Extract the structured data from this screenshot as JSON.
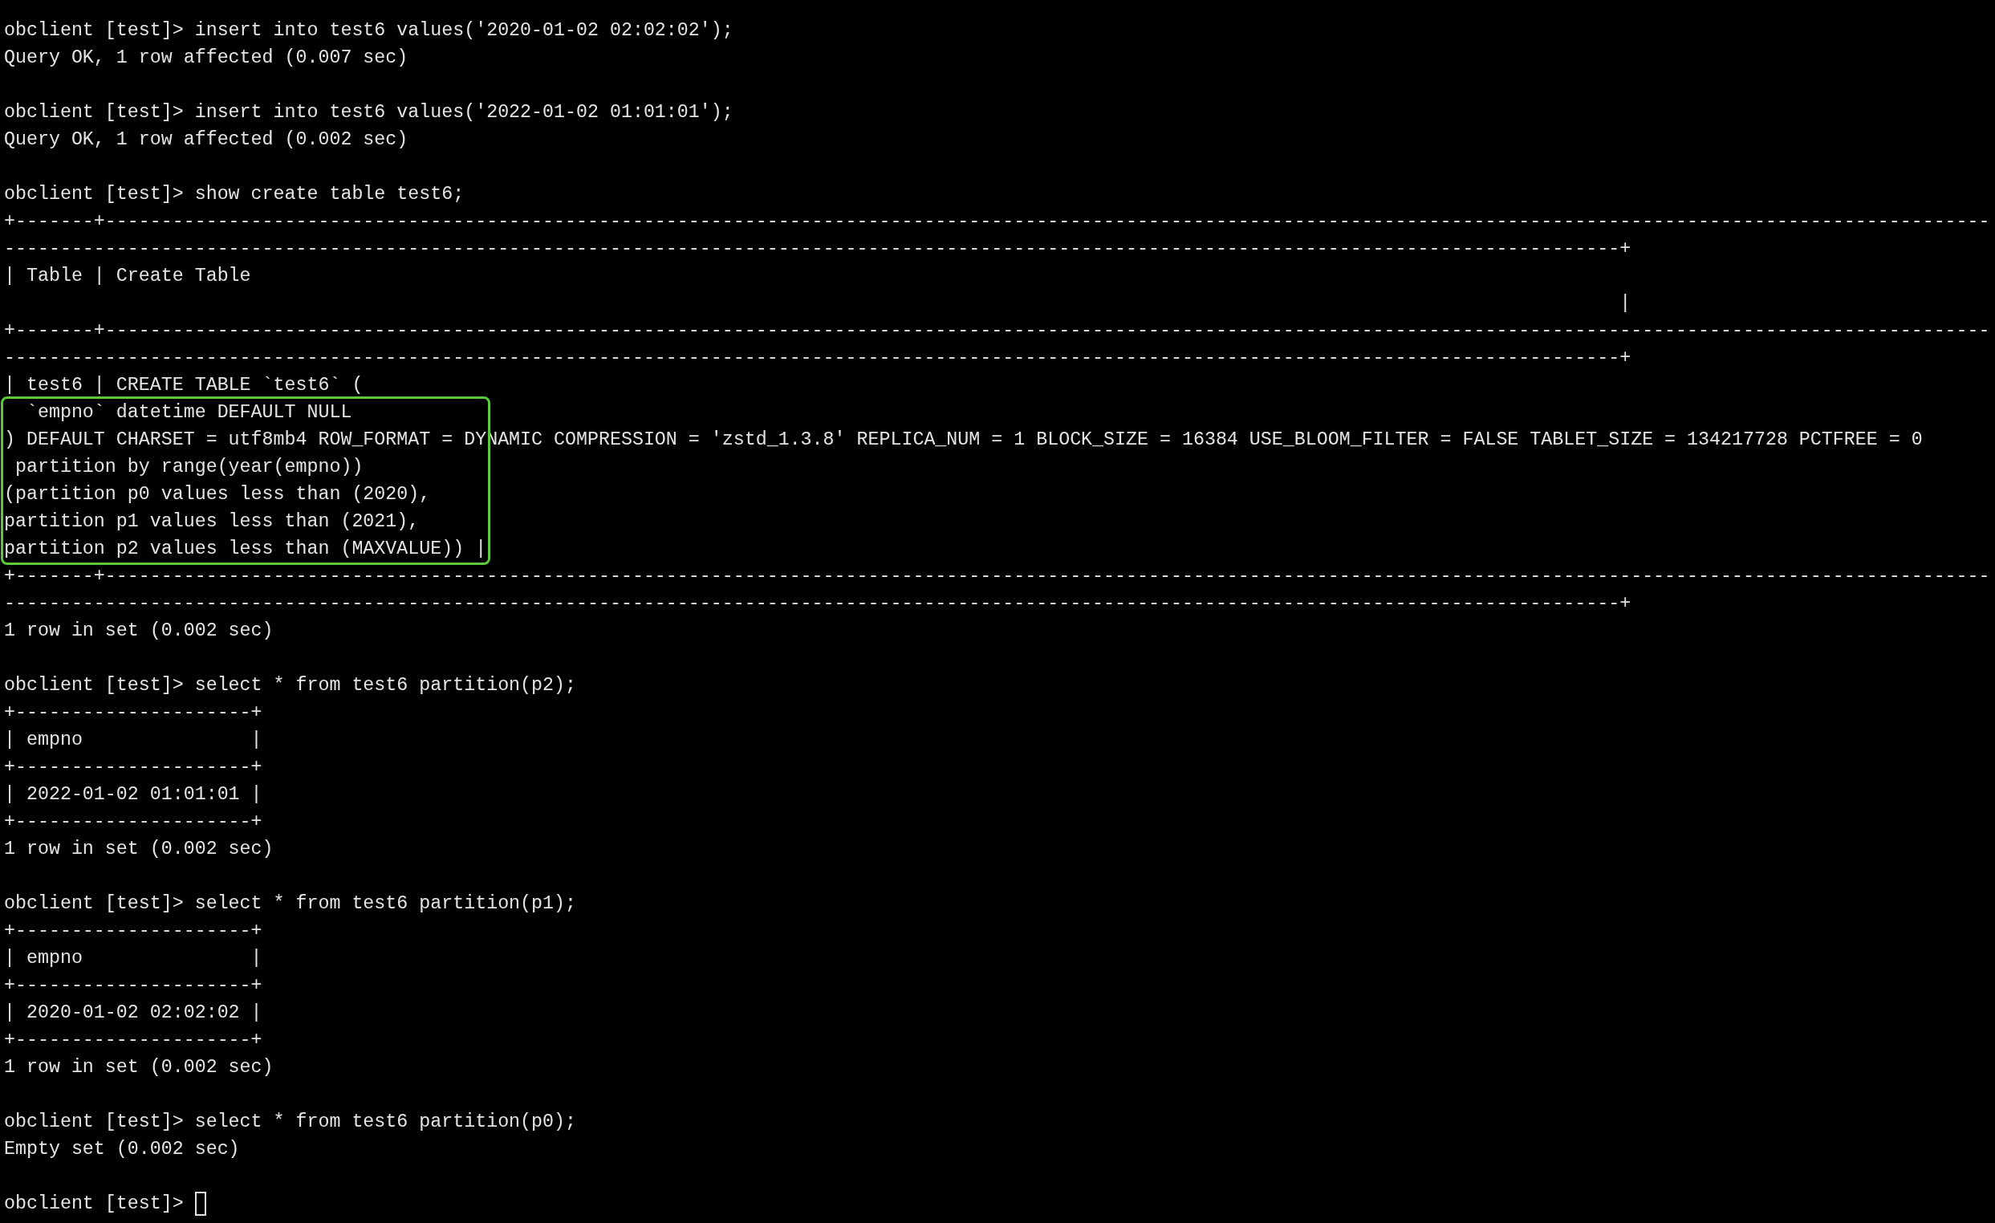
{
  "blocks": [
    {
      "segments": [
        {
          "kind": "plain",
          "lines": [
            "obclient [test]> insert into test6 values('2020-01-02 02:02:02');",
            "Query OK, 1 row affected (0.007 sec)"
          ]
        }
      ]
    },
    {
      "segments": [
        {
          "kind": "plain",
          "lines": [
            "obclient [test]> insert into test6 values('2022-01-02 01:01:01');",
            "Query OK, 1 row affected (0.002 sec)"
          ]
        }
      ]
    },
    {
      "segments": [
        {
          "kind": "plain",
          "lines": [
            "obclient [test]> show create table test6;",
            "+-------+------------------------------------------------------------------------------------------------------------------------------------------------------------------------",
            "------------------------------------------------------------------------------------------------------------------------------------------------+",
            "| Table | Create Table",
            "                                                                                                                                                |",
            "+-------+------------------------------------------------------------------------------------------------------------------------------------------------------------------------",
            "------------------------------------------------------------------------------------------------------------------------------------------------+",
            "| test6 | CREATE TABLE `test6` ("
          ]
        },
        {
          "kind": "highlighted",
          "color": "#5cc83c",
          "lines": [
            "  `empno` datetime DEFAULT NULL",
            ") DEFAULT CHARSET = utf8mb4 ROW_FORMAT = DYNAMIC COMPRESSION = 'zstd_1.3.8' REPLICA_NUM = 1 BLOCK_SIZE = 16384 USE_BLOOM_FILTER = FALSE TABLET_SIZE = 134217728 PCTFREE = 0",
            " partition by range(year(empno))",
            "(partition p0 values less than (2020),",
            "partition p1 values less than (2021),",
            "partition p2 values less than (MAXVALUE)) |"
          ]
        },
        {
          "kind": "plain",
          "lines": [
            "+-------+------------------------------------------------------------------------------------------------------------------------------------------------------------------------",
            "------------------------------------------------------------------------------------------------------------------------------------------------+",
            "1 row in set (0.002 sec)"
          ]
        }
      ]
    },
    {
      "segments": [
        {
          "kind": "plain",
          "lines": [
            "obclient [test]> select * from test6 partition(p2);",
            "+---------------------+",
            "| empno               |",
            "+---------------------+",
            "| 2022-01-02 01:01:01 |",
            "+---------------------+",
            "1 row in set (0.002 sec)"
          ]
        }
      ]
    },
    {
      "segments": [
        {
          "kind": "plain",
          "lines": [
            "obclient [test]> select * from test6 partition(p1);",
            "+---------------------+",
            "| empno               |",
            "+---------------------+",
            "| 2020-01-02 02:02:02 |",
            "+---------------------+",
            "1 row in set (0.002 sec)"
          ]
        }
      ]
    },
    {
      "segments": [
        {
          "kind": "plain",
          "lines": [
            "obclient [test]> select * from test6 partition(p0);",
            "Empty set (0.002 sec)"
          ]
        }
      ]
    }
  ],
  "prompt": {
    "text": "obclient [test]>",
    "cursor": true
  }
}
